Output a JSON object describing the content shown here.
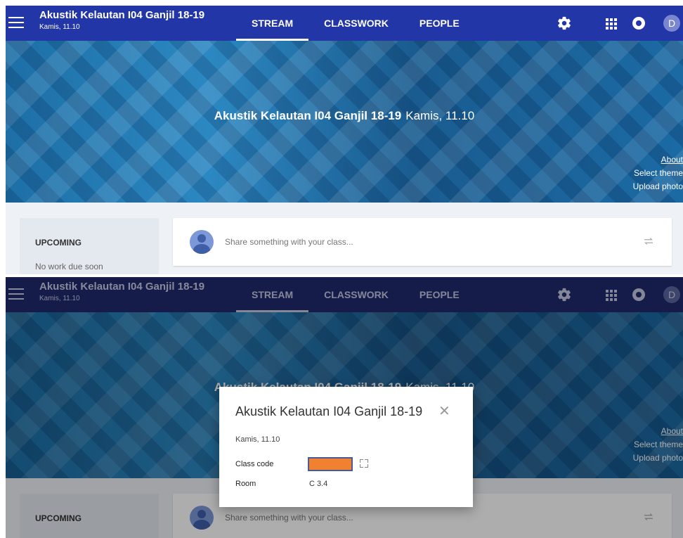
{
  "header": {
    "title": "Akustik Kelautan I04 Ganjil 18-19",
    "subtitle": "Kamis, 11.10",
    "tabs": [
      {
        "label": "STREAM",
        "active": true
      },
      {
        "label": "CLASSWORK",
        "active": false
      },
      {
        "label": "PEOPLE",
        "active": false
      }
    ],
    "avatar_letter": "D",
    "icons": [
      "menu-icon",
      "gear-icon",
      "apps-grid-icon",
      "notification-icon"
    ]
  },
  "banner": {
    "title": "Akustik Kelautan I04 Ganjil 18-19",
    "subtitle": "Kamis, 11.10",
    "links": [
      "About",
      "Select theme",
      "Upload photo"
    ]
  },
  "upcoming": {
    "title": "UPCOMING",
    "empty_text": "No work due soon"
  },
  "share": {
    "placeholder": "Share something with your class..."
  },
  "dialog": {
    "title": "Akustik Kelautan I04 Ganjil 18-19",
    "subtitle": "Kamis, 11.10",
    "class_code_label": "Class code",
    "room_label": "Room",
    "room_value": "C 3.4"
  },
  "colors": {
    "header_bar": "#2336a8",
    "class_code_redaction": "#ef8130"
  }
}
